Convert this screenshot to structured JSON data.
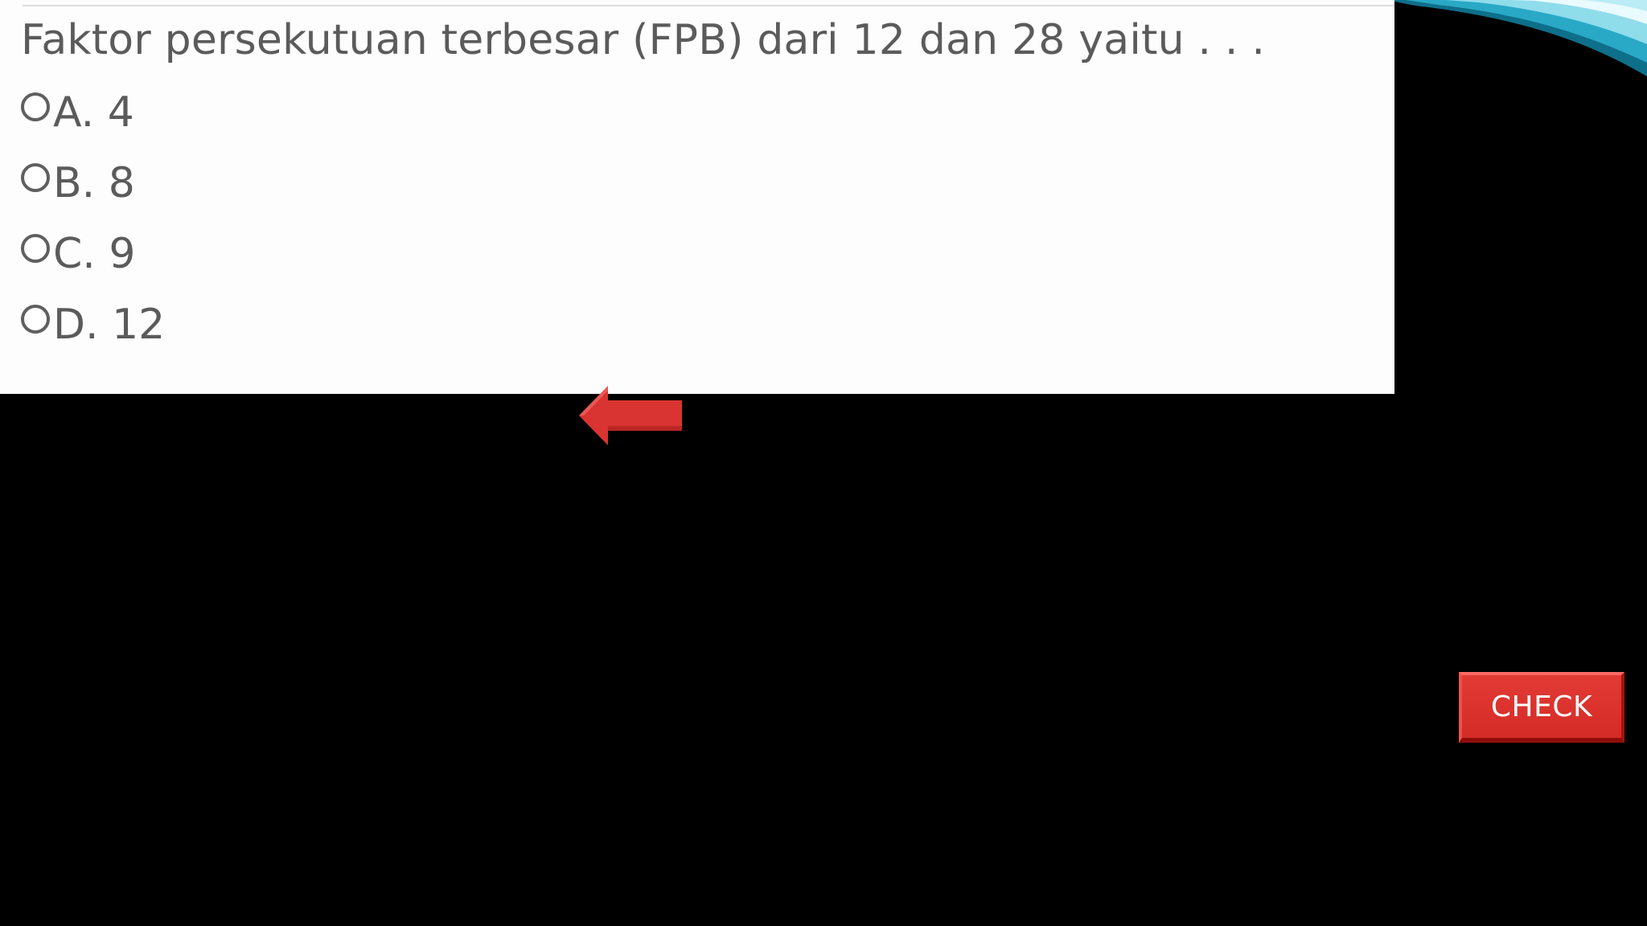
{
  "question": {
    "text": "Faktor persekutuan terbesar (FPB) dari 12 dan 28 yaitu . . .",
    "options": [
      {
        "label": "A. 4",
        "selected": false
      },
      {
        "label": "B. 8",
        "selected": false
      },
      {
        "label": "C. 9",
        "selected": false
      },
      {
        "label": "D. 12",
        "selected": false
      }
    ]
  },
  "navigation": {
    "back_icon": "left-arrow-icon",
    "arrow_color": "#d93431"
  },
  "check_button": {
    "label": "CHECK",
    "color": "#d9302b"
  },
  "decoration": {
    "swoosh_colors": [
      "#7fd6e6",
      "#1f9bb8",
      "#e9fbff"
    ]
  }
}
